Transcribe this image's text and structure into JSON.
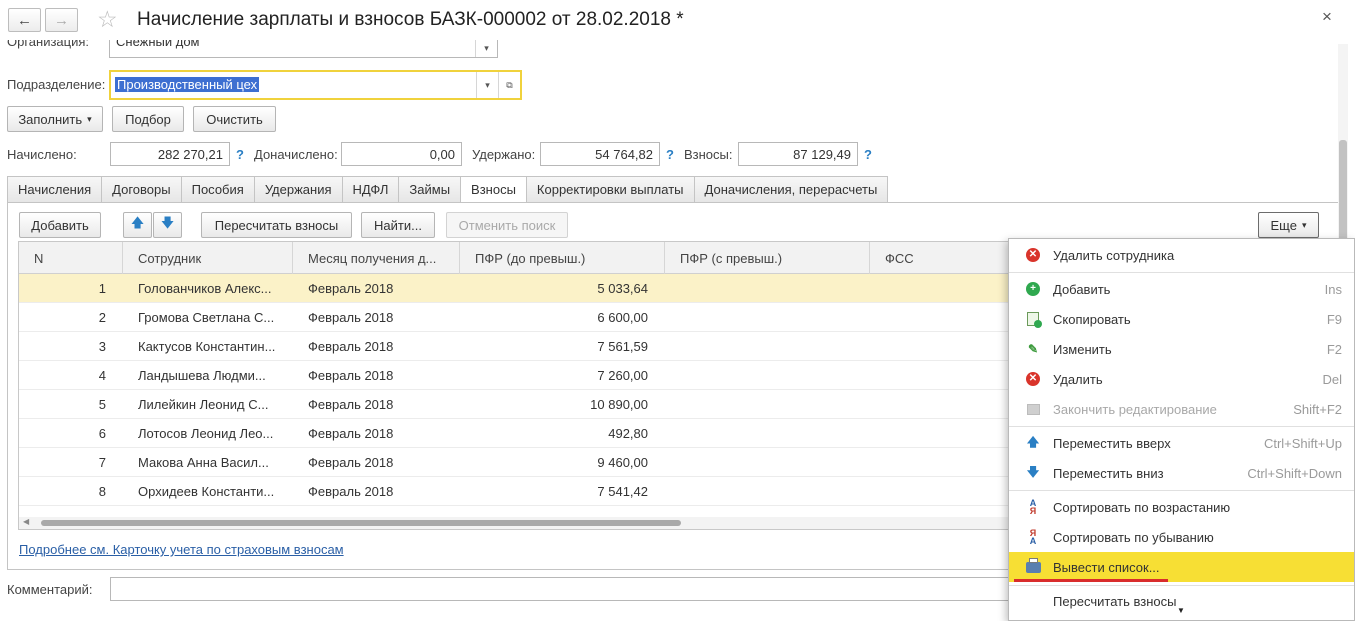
{
  "window": {
    "title": "Начисление зарплаты и взносов БАЗК-000002 от 28.02.2018 *",
    "back_icon": "←",
    "forward_icon": "→",
    "star_icon": "☆",
    "close_icon": "×"
  },
  "form": {
    "organization_label": "Организация:",
    "organization_value": "Снежный дом",
    "division_label": "Подразделение:",
    "division_value": "Производственный цех"
  },
  "toolbar": {
    "fill_label": "Заполнить",
    "select_label": "Подбор",
    "clear_label": "Очистить"
  },
  "totals": {
    "accrued_label": "Начислено:",
    "accrued_value": "282 270,21",
    "additional_label": "Доначислено:",
    "additional_value": "0,00",
    "withheld_label": "Удержано:",
    "withheld_value": "54 764,82",
    "contributions_label": "Взносы:",
    "contributions_value": "87 129,49",
    "help_mark": "?"
  },
  "tabs": [
    "Начисления",
    "Договоры",
    "Пособия",
    "Удержания",
    "НДФЛ",
    "Займы",
    "Взносы",
    "Корректировки выплаты",
    "Доначисления, перерасчеты"
  ],
  "active_tab": "Взносы",
  "grid_toolbar": {
    "add_label": "Добавить",
    "recalc_label": "Пересчитать взносы",
    "find_label": "Найти...",
    "cancel_search_label": "Отменить поиск",
    "more_label": "Еще"
  },
  "table": {
    "columns": [
      "N",
      "Сотрудник",
      "Месяц получения д...",
      "ПФР (до превыш.)",
      "ПФР (с превыш.)",
      "ФСС"
    ],
    "rows": [
      {
        "n": "1",
        "employee": "Голованчиков Алекс...",
        "month": "Февраль 2018",
        "pfr": "5 033,64"
      },
      {
        "n": "2",
        "employee": "Громова Светлана С...",
        "month": "Февраль 2018",
        "pfr": "6 600,00"
      },
      {
        "n": "3",
        "employee": "Кактусов Константин...",
        "month": "Февраль 2018",
        "pfr": "7 561,59"
      },
      {
        "n": "4",
        "employee": "Ландышева Людми...",
        "month": "Февраль 2018",
        "pfr": "7 260,00"
      },
      {
        "n": "5",
        "employee": "Лилейкин Леонид С...",
        "month": "Февраль 2018",
        "pfr": "10 890,00"
      },
      {
        "n": "6",
        "employee": "Лотосов Леонид Лео...",
        "month": "Февраль 2018",
        "pfr": "492,80"
      },
      {
        "n": "7",
        "employee": "Макова Анна Васил...",
        "month": "Февраль 2018",
        "pfr": "9 460,00"
      },
      {
        "n": "8",
        "employee": "Орхидеев Константи...",
        "month": "Февраль 2018",
        "pfr": "7 541,42"
      }
    ]
  },
  "footer": {
    "link_text": "Подробнее см. Карточку учета по страховым взносам",
    "comment_label": "Комментарий:"
  },
  "menu": {
    "items": [
      {
        "label": "Удалить сотрудника",
        "shortcut": "",
        "icon": "remove-employee-icon"
      },
      {
        "label": "Добавить",
        "shortcut": "Ins",
        "icon": "add-icon"
      },
      {
        "label": "Скопировать",
        "shortcut": "F9",
        "icon": "copy-icon"
      },
      {
        "label": "Изменить",
        "shortcut": "F2",
        "icon": "edit-icon"
      },
      {
        "label": "Удалить",
        "shortcut": "Del",
        "icon": "delete-icon"
      },
      {
        "label": "Закончить редактирование",
        "shortcut": "Shift+F2",
        "icon": "end-edit-icon"
      },
      {
        "label": "Переместить вверх",
        "shortcut": "Ctrl+Shift+Up",
        "icon": "move-up-icon"
      },
      {
        "label": "Переместить вниз",
        "shortcut": "Ctrl+Shift+Down",
        "icon": "move-down-icon"
      },
      {
        "label": "Сортировать по возрастанию",
        "shortcut": "",
        "icon": "sort-asc-icon"
      },
      {
        "label": "Сортировать по убыванию",
        "shortcut": "",
        "icon": "sort-desc-icon"
      },
      {
        "label": "Вывести список...",
        "shortcut": "",
        "icon": "print-list-icon"
      },
      {
        "label": "Пересчитать взносы",
        "shortcut": "",
        "icon": ""
      }
    ]
  },
  "colors": {
    "accent_yellow": "#f7df34",
    "selection_row": "#fbf2c8",
    "link_blue": "#2a5fa6",
    "red_underline": "#d92c2c"
  }
}
